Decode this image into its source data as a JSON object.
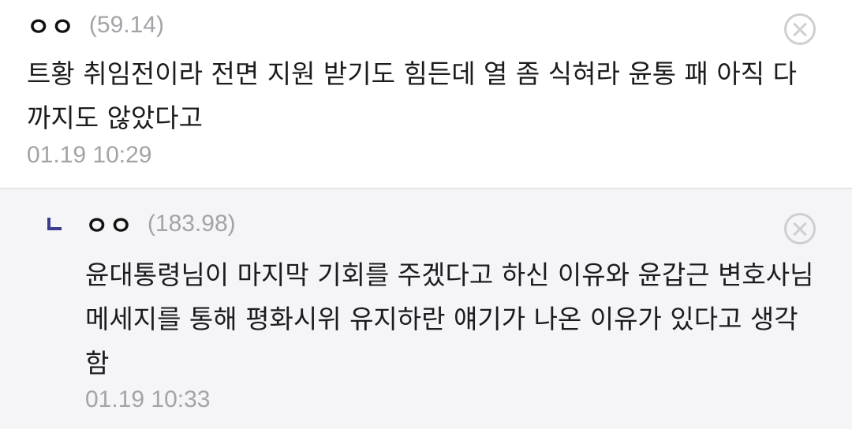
{
  "comments": [
    {
      "author": "ㅇㅇ",
      "score": "(59.14)",
      "text": "트황 취임전이라 전면 지원 받기도 힘든데 열 좀 식혀라 윤통 패 아직 다 까지도 않았다고",
      "time": "01.19 10:29"
    }
  ],
  "reply": {
    "author": "ㅇㅇ",
    "score": "(183.98)",
    "text": "윤대통령님이 마지막 기회를 주겠다고 하신 이유와 윤갑근 변호사님 메세지를 통해 평화시위 유지하란 얘기가 나온 이유가 있다고 생각함",
    "time": "01.19 10:33"
  },
  "icons": {
    "delete": "close-circle-icon",
    "reply_indicator": "reply-arrow-icon"
  },
  "colors": {
    "reply_arrow": "#3d3d8f",
    "meta_gray": "#a3a3a8",
    "reply_bg": "#f5f5f7"
  }
}
